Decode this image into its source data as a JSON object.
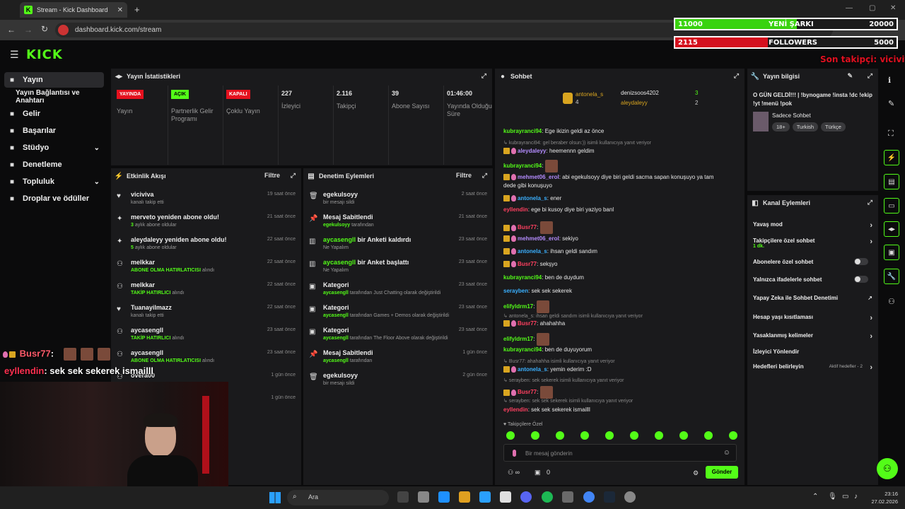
{
  "browser": {
    "tab_title": "Stream - Kick Dashboard",
    "url": "dashboard.kick.com/stream"
  },
  "brand": {
    "logo": "KICK",
    "accent": "#53fc18"
  },
  "sidebar": {
    "items": [
      {
        "label": "Yayın",
        "icon": "broadcast-icon"
      },
      {
        "label": "Yayın Bağlantısı ve Anahtarı",
        "icon": ""
      },
      {
        "label": "Gelir",
        "icon": "money-icon"
      },
      {
        "label": "Başarılar",
        "icon": "trophy-icon"
      },
      {
        "label": "Stüdyo",
        "icon": "studio-icon"
      },
      {
        "label": "Denetleme",
        "icon": "hammer-icon"
      },
      {
        "label": "Topluluk",
        "icon": "community-icon"
      },
      {
        "label": "Droplar ve ödüller",
        "icon": "gift-icon"
      }
    ]
  },
  "stats": {
    "title": "Yayın İstatistikleri",
    "items": [
      {
        "badge": "YAYINDA",
        "label": "Yayın"
      },
      {
        "badge": "AÇIK",
        "label": "Partnerlik Gelir Programı"
      },
      {
        "badge": "KAPALI",
        "label": "Çoklu Yayın"
      },
      {
        "value": "227",
        "label": "İzleyici"
      },
      {
        "value": "2.116",
        "label": "Takipçi"
      },
      {
        "value": "39",
        "label": "Abone Sayısı"
      },
      {
        "value": "01:46:00",
        "label": "Yayında Olduğu Süre"
      }
    ]
  },
  "activity": {
    "title": "Etkinlik Akışı",
    "filter": "Filtre",
    "rows": [
      {
        "t": "viciviva",
        "s": "kanalı takip etti",
        "g": "",
        "time": "19 saat önce"
      },
      {
        "t": "merveto yeniden abone oldu!",
        "g": "3",
        "s": "aylık abone oldular",
        "time": "21 saat önce"
      },
      {
        "t": "aleydaleyy yeniden abone oldu!",
        "g": "5",
        "s": "aylık abone oldular",
        "time": "22 saat önce"
      },
      {
        "t": "melkkar",
        "g": "ABONE OLMA HATIRLATICISI",
        "s": "alındı",
        "time": "22 saat önce"
      },
      {
        "t": "melkkar",
        "g": "TAKİP HATIRLICI",
        "s": "alındı",
        "time": "22 saat önce"
      },
      {
        "t": "Tuanayilmazz",
        "g": "",
        "s": "kanalı takip etti",
        "time": "22 saat önce"
      },
      {
        "t": "aycasengll",
        "g": "TAKİP HATIRLICI",
        "s": "alındı",
        "time": "23 saat önce"
      },
      {
        "t": "aycasengll",
        "g": "ABONE OLMA HATIRLATICISI",
        "s": "alındı",
        "time": "23 saat önce"
      },
      {
        "t": "overa00",
        "g": "",
        "s": "",
        "time": "1 gün önce"
      },
      {
        "t": "",
        "g": "",
        "s": "",
        "time": "1 gün önce"
      }
    ]
  },
  "moderation": {
    "title": "Denetim Eylemleri",
    "filter": "Filtre",
    "rows": [
      {
        "t": "egekulsoyy",
        "g": "",
        "s": "bir mesajı sildi",
        "time": "2 saat önce"
      },
      {
        "t": "Mesaj Sabitlendi",
        "g": "egekulsoyy",
        "s": "tarafından",
        "time": "21 saat önce"
      },
      {
        "tg": "aycasengll",
        "t": " bir Anketi kaldırdı",
        "s": "Ne Yapalım",
        "g": "",
        "time": "23 saat önce"
      },
      {
        "tg": "aycasengll",
        "t": " bir Anket başlattı",
        "s": "Ne Yapalım",
        "g": "",
        "time": "23 saat önce"
      },
      {
        "t": "Kategori",
        "g": "aycasengll",
        "s": "tarafından Just Chatting olarak değiştirildi",
        "time": "23 saat önce"
      },
      {
        "t": "Kategori",
        "g": "aycasengll",
        "s": "tarafından Games + Demos olarak değiştirildi",
        "time": "23 saat önce"
      },
      {
        "t": "Kategori",
        "g": "aycasengll",
        "s": "tarafından The Floor Above olarak değiştirildi",
        "time": "23 saat önce"
      },
      {
        "t": "Mesaj Sabitlendi",
        "g": "aycasengll",
        "s": "tarafından",
        "time": "1 gün önce"
      },
      {
        "t": "egekulsoyy",
        "g": "",
        "s": "bir mesajı sildi",
        "time": "2 gün önce"
      }
    ]
  },
  "chat": {
    "title": "Sohbet",
    "top": [
      {
        "name": "antonela_s",
        "count": "4"
      },
      {
        "name": "denizsoos4202",
        "count": "3"
      },
      {
        "name": "aleydaleyy",
        "count": "2"
      }
    ],
    "messages": [
      {
        "u": "kubrayranci94",
        "c": "#53fc18",
        "m": "Ege ikizin geldi az önce"
      },
      {
        "reply": "kubrayranci94: gel beraber olsun:)) isimli kullanıcıya yanıt veriyor"
      },
      {
        "u": "aleydaleyy",
        "c": "#b48cff",
        "m": "heemennn geldim"
      },
      {
        "u": "kubrayranci94",
        "c": "#53fc18",
        "m": ""
      },
      {
        "u": "mehmet06_erol",
        "c": "#b48cff",
        "m": "abi egekulsoyy diye biri geldi sacma sapan konuşuyo ya tam"
      },
      {
        "u": "",
        "c": "#fff",
        "m": "dede gibi konuşuyo"
      },
      {
        "u": "antonela_s",
        "c": "#3ab0ff",
        "m": "ener"
      },
      {
        "u": "eyllendin",
        "c": "#ff4060",
        "m": "ege bi kusoy diye biri yaziyo banl"
      },
      {
        "u": "Busr77",
        "c": "#ff4060",
        "m": ""
      },
      {
        "u": "mehmet06_erol",
        "c": "#b48cff",
        "m": "sekiyo"
      },
      {
        "u": "antonela_s",
        "c": "#3ab0ff",
        "m": "ihsan geldi sandım"
      },
      {
        "u": "Busr77",
        "c": "#ff4060",
        "m": "sekşyo"
      },
      {
        "u": "kubrayranci94",
        "c": "#53fc18",
        "m": "ben de duydum"
      },
      {
        "u": "serayben",
        "c": "#3ab0ff",
        "m": "sek sek sekerek"
      },
      {
        "u": "elifyldrm17",
        "c": "#53fc18",
        "m": ""
      },
      {
        "reply": "antonela_s: ihsan geldi sandım isimli kullanıcıya yanıt veriyor"
      },
      {
        "u": "Busr77",
        "c": "#ff4060",
        "m": "ahahahha"
      },
      {
        "u": "elifyldrm17",
        "c": "#53fc18",
        "m": ""
      },
      {
        "u": "kubrayranci94",
        "c": "#53fc18",
        "m": "ben de duyuyorum"
      },
      {
        "reply": "Busr77: ahahahha isimli kullanıcıya yanıt veriyor"
      },
      {
        "u": "antonela_s",
        "c": "#3ab0ff",
        "m": "yemin ederim :D"
      },
      {
        "reply": "serayben: sek sekerek isimli kullanıcıya yanıt veriyor"
      },
      {
        "u": "Busr77",
        "c": "#ff4060",
        "m": ""
      },
      {
        "reply": "serayben: sek sek sekerek isimli kullanıcıya yanıt veriyor"
      },
      {
        "u": "eyllendin",
        "c": "#ff4060",
        "m": "sek sek sekerek ismailll"
      }
    ],
    "followers_only": "Takipçilere Özel",
    "placeholder": "Bir mesaj gönderin",
    "send": "Gönder",
    "viewers_inf": "∞",
    "count_zero": "0"
  },
  "info": {
    "title": "Yayın bilgisi",
    "stream_title": "O GÜN GELDİ!!! | !bynogame !insta !dc !ekip !yt !menü !pok",
    "category": "Sadece Sohbet",
    "tags": [
      "18+",
      "Turkish",
      "Türkçe"
    ]
  },
  "actions": {
    "title": "Kanal Eylemleri",
    "items": [
      {
        "label": "Yavaş mod",
        "type": "chev"
      },
      {
        "label": "Takipçilere özel sohbet",
        "sub": "1 dk.",
        "type": "chev"
      },
      {
        "label": "Abonelere özel sohbet",
        "type": "toggle"
      },
      {
        "label": "Yalnızca ifadelerle sohbet",
        "type": "toggle"
      },
      {
        "label": "Yapay Zeka ile Sohbet Denetimi",
        "type": "ext"
      },
      {
        "label": "Hesap yaşı kısıtlaması",
        "type": "chev"
      },
      {
        "label": "Yasaklanmış kelimeler",
        "type": "chev"
      },
      {
        "label": "İzleyici Yönlendir",
        "type": ""
      },
      {
        "label": "Hedefleri belirleyin",
        "sub": "Aktif hedefler - 2",
        "type": "chev"
      }
    ]
  },
  "overlay": {
    "bar1_left": "11000",
    "bar1_mid": "YENİ ŞARKI",
    "bar1_right": "20000",
    "bar1_fill": 0.55,
    "bar2_left": "2115",
    "bar2_mid": "FOLLOWERS",
    "bar2_right": "5000",
    "bar2_fill": 0.42,
    "last_follower": "Son takipçi: viciviva",
    "chat1_user": "Busr77",
    "chat1_sep": ":",
    "chat2_user": "eyllendin",
    "chat2_msg": ": sek sek sekerek ismailll"
  },
  "taskbar": {
    "search": "Ara",
    "time": "23:16",
    "date": "27.02.2026"
  }
}
